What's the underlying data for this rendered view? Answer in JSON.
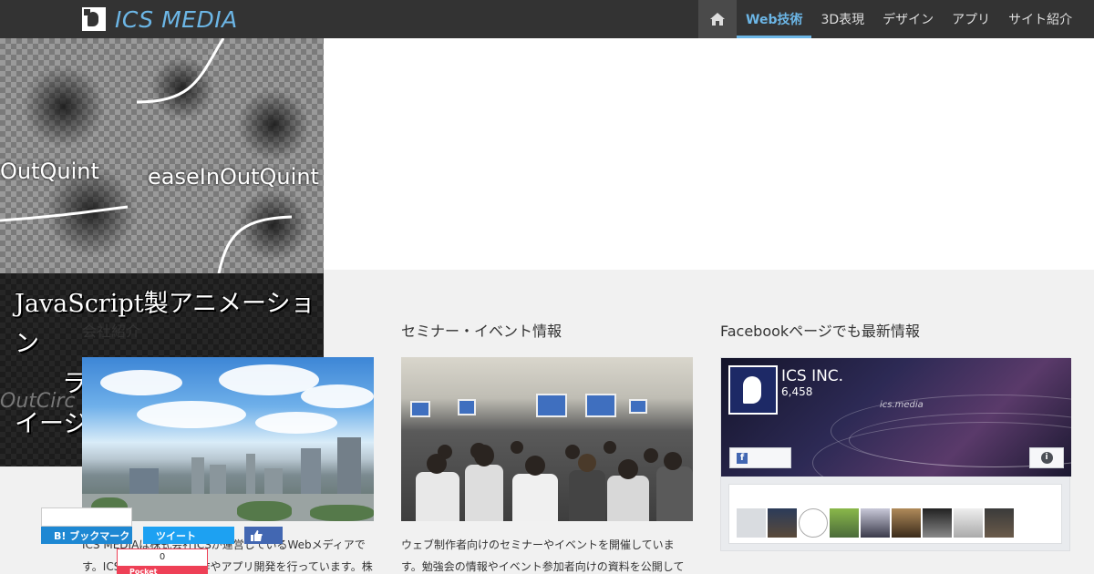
{
  "header": {
    "logo_text": "ICS MEDIA",
    "accent_color": "#6cb6e6",
    "nav": {
      "home_icon": "home-icon",
      "items": [
        {
          "label": "Web技術",
          "active": true
        },
        {
          "label": "3D表現",
          "active": false
        },
        {
          "label": "デザイン",
          "active": false
        },
        {
          "label": "アプリ",
          "active": false
        },
        {
          "label": "サイト紹介",
          "active": false
        }
      ]
    }
  },
  "hero": {
    "labels": [
      "OutQuint",
      "easeInOutQuint"
    ],
    "title_lines": [
      "JavaScript製アニメーション",
      "ライブラリの原理!",
      "イージング"
    ],
    "subtitle": "OutCirc"
  },
  "columns": [
    {
      "title": "会社紹介",
      "description": "ICS MEDIAは株式会社ICSが運営しているWebメディアです。ICSはWebサイト制作やアプリ開発を行っています。株式会社ICSが発信するWeb技術やデザイン技術の情報"
    },
    {
      "title": "セミナー・イベント情報",
      "description": "ウェブ制作者向けのセミナーやイベントを開催しています。勉強会の情報やイベント参加者向けの資料を公開しています。ICSのセミナー情報はこちらをご覧ください。"
    },
    {
      "title": "Facebookページでも最新情報",
      "description": ""
    }
  ],
  "facebook": {
    "page_name": "ICS INC.",
    "likes": "6,458",
    "brand_text": "ics.media",
    "brand_color": "#4267b2"
  },
  "share": {
    "hatena_label": "B! ブックマーク",
    "hatena_count": "",
    "tweet_label": "ツイート",
    "pocket_label": "Pocket",
    "pocket_count": "0"
  }
}
